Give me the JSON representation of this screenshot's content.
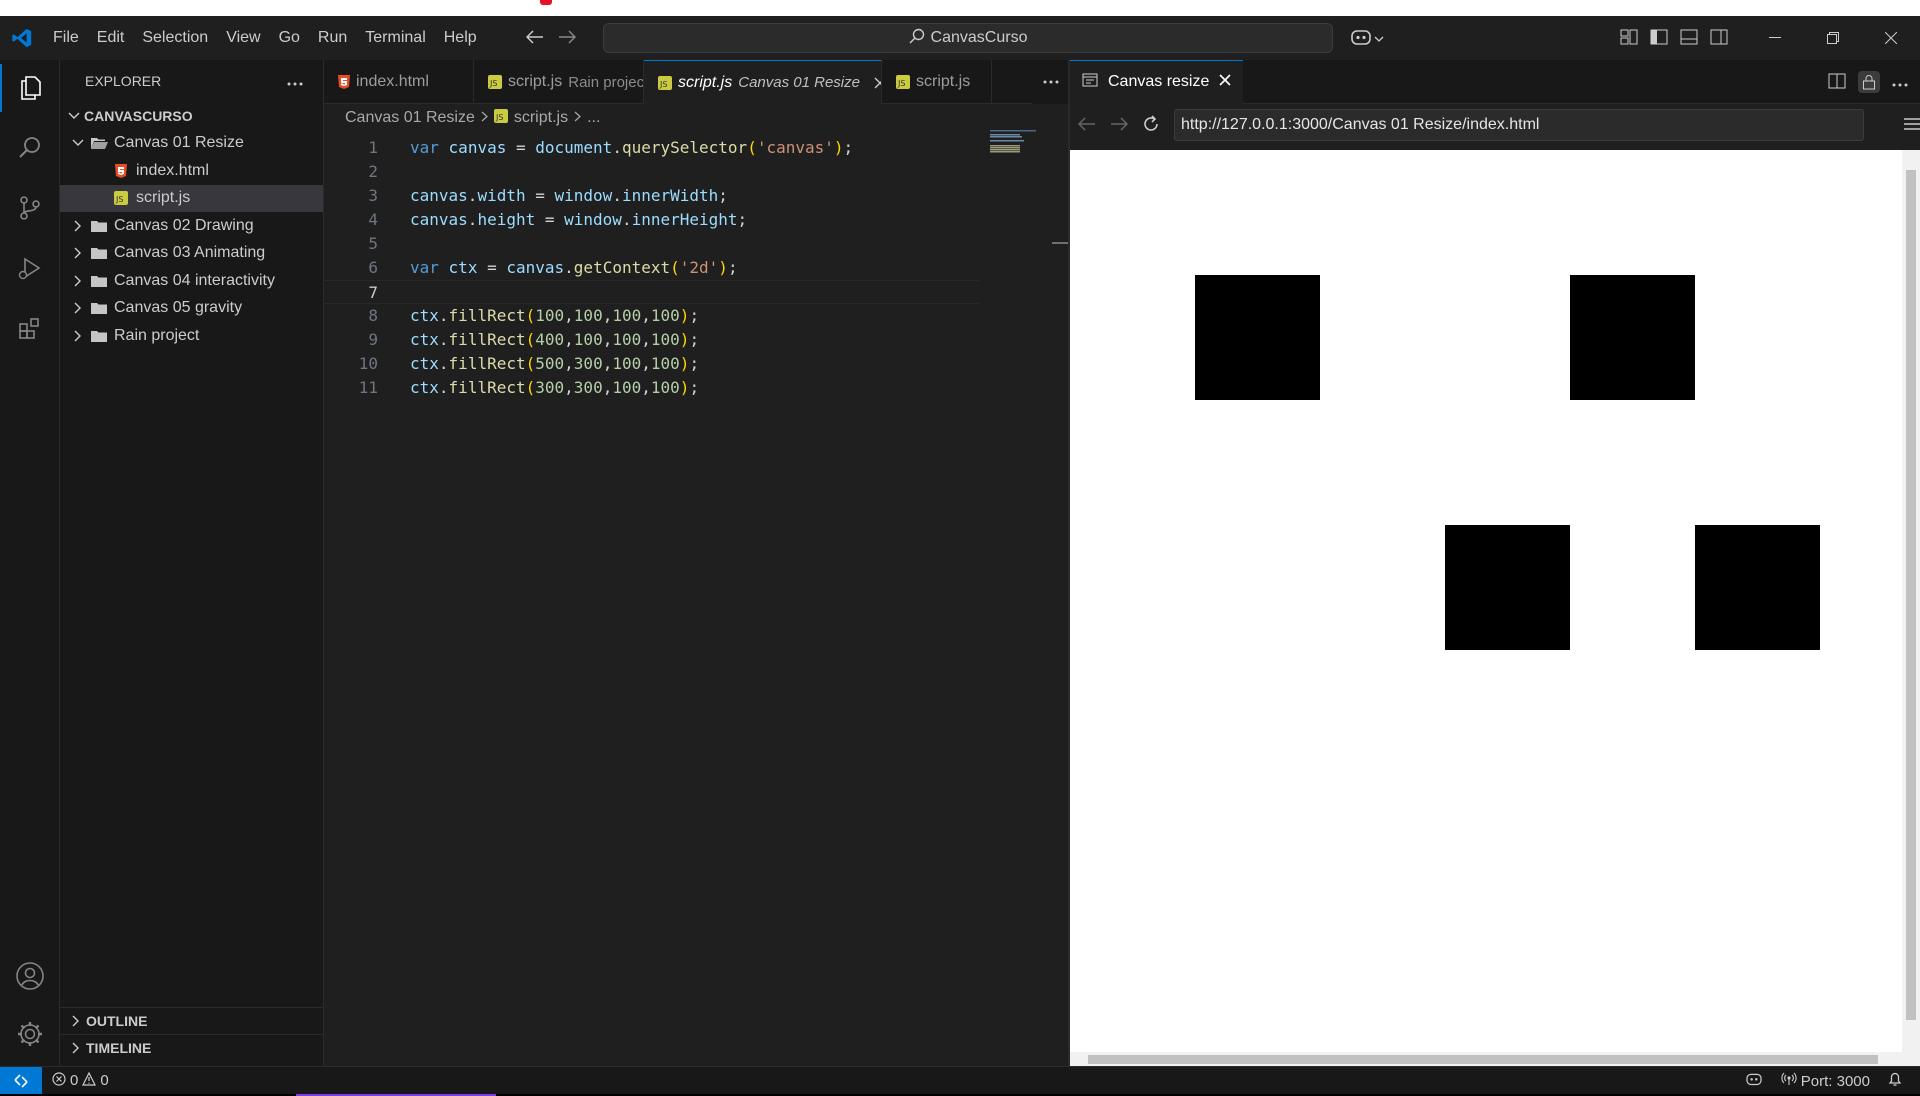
{
  "menu": [
    "File",
    "Edit",
    "Selection",
    "View",
    "Go",
    "Run",
    "Terminal",
    "Help"
  ],
  "command_center": "CanvasCurso",
  "explorer": {
    "title": "EXPLORER",
    "root": "CANVASCURSO",
    "items": [
      {
        "label": "Canvas 01 Resize",
        "kind": "folder-open",
        "depth": 1
      },
      {
        "label": "index.html",
        "kind": "html",
        "depth": 2
      },
      {
        "label": "script.js",
        "kind": "js",
        "depth": 2,
        "selected": true
      },
      {
        "label": "Canvas 02 Drawing",
        "kind": "folder",
        "depth": 1
      },
      {
        "label": "Canvas 03 Animating",
        "kind": "folder",
        "depth": 1
      },
      {
        "label": "Canvas 04 interactivity",
        "kind": "folder",
        "depth": 1
      },
      {
        "label": "Canvas 05 gravity",
        "kind": "folder",
        "depth": 1
      },
      {
        "label": "Rain project",
        "kind": "folder",
        "depth": 1
      }
    ],
    "outline": "OUTLINE",
    "timeline": "TIMELINE"
  },
  "tabs": [
    {
      "name": "index.html",
      "desc": "",
      "icon": "html-icon"
    },
    {
      "name": "script.js",
      "desc": "Rain project",
      "icon": "js-icon"
    },
    {
      "name": "script.js",
      "desc": "Canvas 01 Resize",
      "icon": "js-icon",
      "active": true
    },
    {
      "name": "script.js",
      "desc": "",
      "icon": "js-icon"
    }
  ],
  "breadcrumb": {
    "folder": "Canvas 01 Resize",
    "file": "script.js",
    "more": "..."
  },
  "code": {
    "current_line": 7,
    "lines": [
      [
        [
          "kw",
          "var"
        ],
        [
          "pun",
          " "
        ],
        [
          "var",
          "canvas"
        ],
        [
          "pun",
          " = "
        ],
        [
          "var",
          "document"
        ],
        [
          "pun",
          "."
        ],
        [
          "fn",
          "querySelector"
        ],
        [
          "br",
          "("
        ],
        [
          "str",
          "'canvas'"
        ],
        [
          "br",
          ")"
        ],
        [
          "pun",
          ";"
        ]
      ],
      [],
      [
        [
          "var",
          "canvas"
        ],
        [
          "pun",
          "."
        ],
        [
          "var",
          "width"
        ],
        [
          "pun",
          " = "
        ],
        [
          "var",
          "window"
        ],
        [
          "pun",
          "."
        ],
        [
          "var",
          "innerWidth"
        ],
        [
          "pun",
          ";"
        ]
      ],
      [
        [
          "var",
          "canvas"
        ],
        [
          "pun",
          "."
        ],
        [
          "var",
          "height"
        ],
        [
          "pun",
          " = "
        ],
        [
          "var",
          "window"
        ],
        [
          "pun",
          "."
        ],
        [
          "var",
          "innerHeight"
        ],
        [
          "pun",
          ";"
        ]
      ],
      [],
      [
        [
          "kw",
          "var"
        ],
        [
          "pun",
          " "
        ],
        [
          "var",
          "ctx"
        ],
        [
          "pun",
          " = "
        ],
        [
          "var",
          "canvas"
        ],
        [
          "pun",
          "."
        ],
        [
          "fn",
          "getContext"
        ],
        [
          "br",
          "("
        ],
        [
          "str",
          "'2d'"
        ],
        [
          "br",
          ")"
        ],
        [
          "pun",
          ";"
        ]
      ],
      [],
      [
        [
          "var",
          "ctx"
        ],
        [
          "pun",
          "."
        ],
        [
          "fn",
          "fillRect"
        ],
        [
          "br",
          "("
        ],
        [
          "num",
          "100"
        ],
        [
          "pun",
          ","
        ],
        [
          "num",
          "100"
        ],
        [
          "pun",
          ","
        ],
        [
          "num",
          "100"
        ],
        [
          "pun",
          ","
        ],
        [
          "num",
          "100"
        ],
        [
          "br",
          ")"
        ],
        [
          "pun",
          ";"
        ]
      ],
      [
        [
          "var",
          "ctx"
        ],
        [
          "pun",
          "."
        ],
        [
          "fn",
          "fillRect"
        ],
        [
          "br",
          "("
        ],
        [
          "num",
          "400"
        ],
        [
          "pun",
          ","
        ],
        [
          "num",
          "100"
        ],
        [
          "pun",
          ","
        ],
        [
          "num",
          "100"
        ],
        [
          "pun",
          ","
        ],
        [
          "num",
          "100"
        ],
        [
          "br",
          ")"
        ],
        [
          "pun",
          ";"
        ]
      ],
      [
        [
          "var",
          "ctx"
        ],
        [
          "pun",
          "."
        ],
        [
          "fn",
          "fillRect"
        ],
        [
          "br",
          "("
        ],
        [
          "num",
          "500"
        ],
        [
          "pun",
          ","
        ],
        [
          "num",
          "300"
        ],
        [
          "pun",
          ","
        ],
        [
          "num",
          "100"
        ],
        [
          "pun",
          ","
        ],
        [
          "num",
          "100"
        ],
        [
          "br",
          ")"
        ],
        [
          "pun",
          ";"
        ]
      ],
      [
        [
          "var",
          "ctx"
        ],
        [
          "pun",
          "."
        ],
        [
          "fn",
          "fillRect"
        ],
        [
          "br",
          "("
        ],
        [
          "num",
          "300"
        ],
        [
          "pun",
          ","
        ],
        [
          "num",
          "300"
        ],
        [
          "pun",
          ","
        ],
        [
          "num",
          "100"
        ],
        [
          "pun",
          ","
        ],
        [
          "num",
          "100"
        ],
        [
          "br",
          ")"
        ],
        [
          "pun",
          ";"
        ]
      ]
    ]
  },
  "browser": {
    "tab_title": "Canvas resize",
    "url": "http://127.0.0.1:3000/Canvas 01 Resize/index.html"
  },
  "status": {
    "errors": "0",
    "warnings": "0",
    "port": "Port: 3000"
  },
  "colors": {
    "accent": "#0078d4",
    "html_icon": "#e44d26",
    "js_icon": "#cbcb41",
    "folder": "#c5c5c5"
  }
}
